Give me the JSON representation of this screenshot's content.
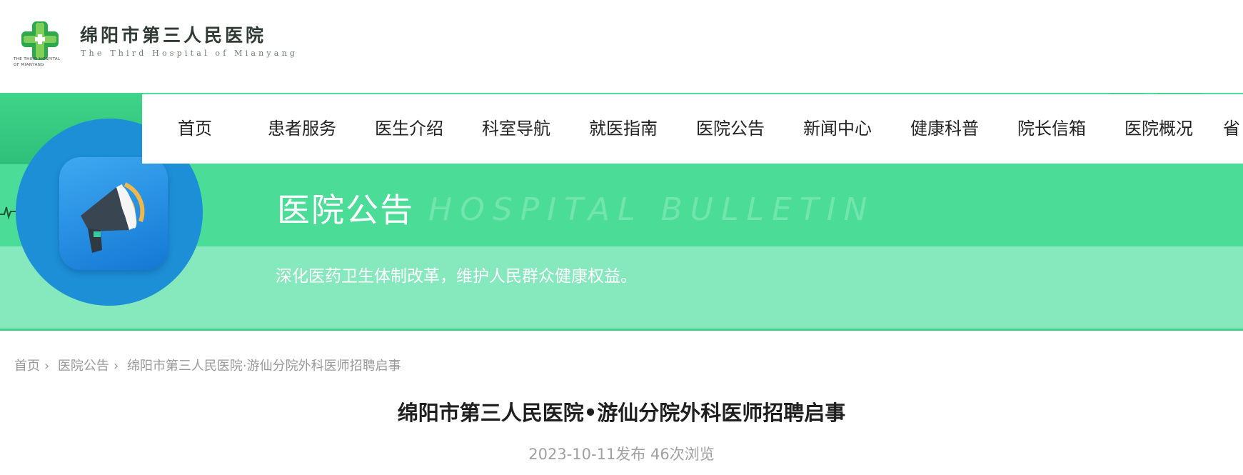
{
  "logo": {
    "title": "绵阳市第三人民医院",
    "subtitle": "The Third Hospital of Mianyang",
    "tiny_line1": "THE THIRD HOSPITAL",
    "tiny_line2": "OF MIANYANG"
  },
  "nav": {
    "items": [
      "首页",
      "患者服务",
      "医生介绍",
      "科室导航",
      "就医指南",
      "医院公告",
      "新闻中心",
      "健康科普",
      "院长信箱",
      "医院概况",
      "省"
    ]
  },
  "banner": {
    "title": "医院公告",
    "title_en": "HOSPITAL BULLETIN",
    "slogan": "深化医药卫生体制改革，维护人民群众健康权益。",
    "colors": {
      "primary": "#4bdd97",
      "light": "#86e8bd",
      "circle": "#1d8fd6"
    },
    "icon": "megaphone-icon"
  },
  "breadcrumb": {
    "items": [
      "首页",
      "医院公告",
      "绵阳市第三人民医院·游仙分院外科医师招聘启事"
    ],
    "separator": "›"
  },
  "article": {
    "title": "绵阳市第三人民医院•游仙分院外科医师招聘启事",
    "meta": "2023-10-11发布 46次浏览"
  }
}
